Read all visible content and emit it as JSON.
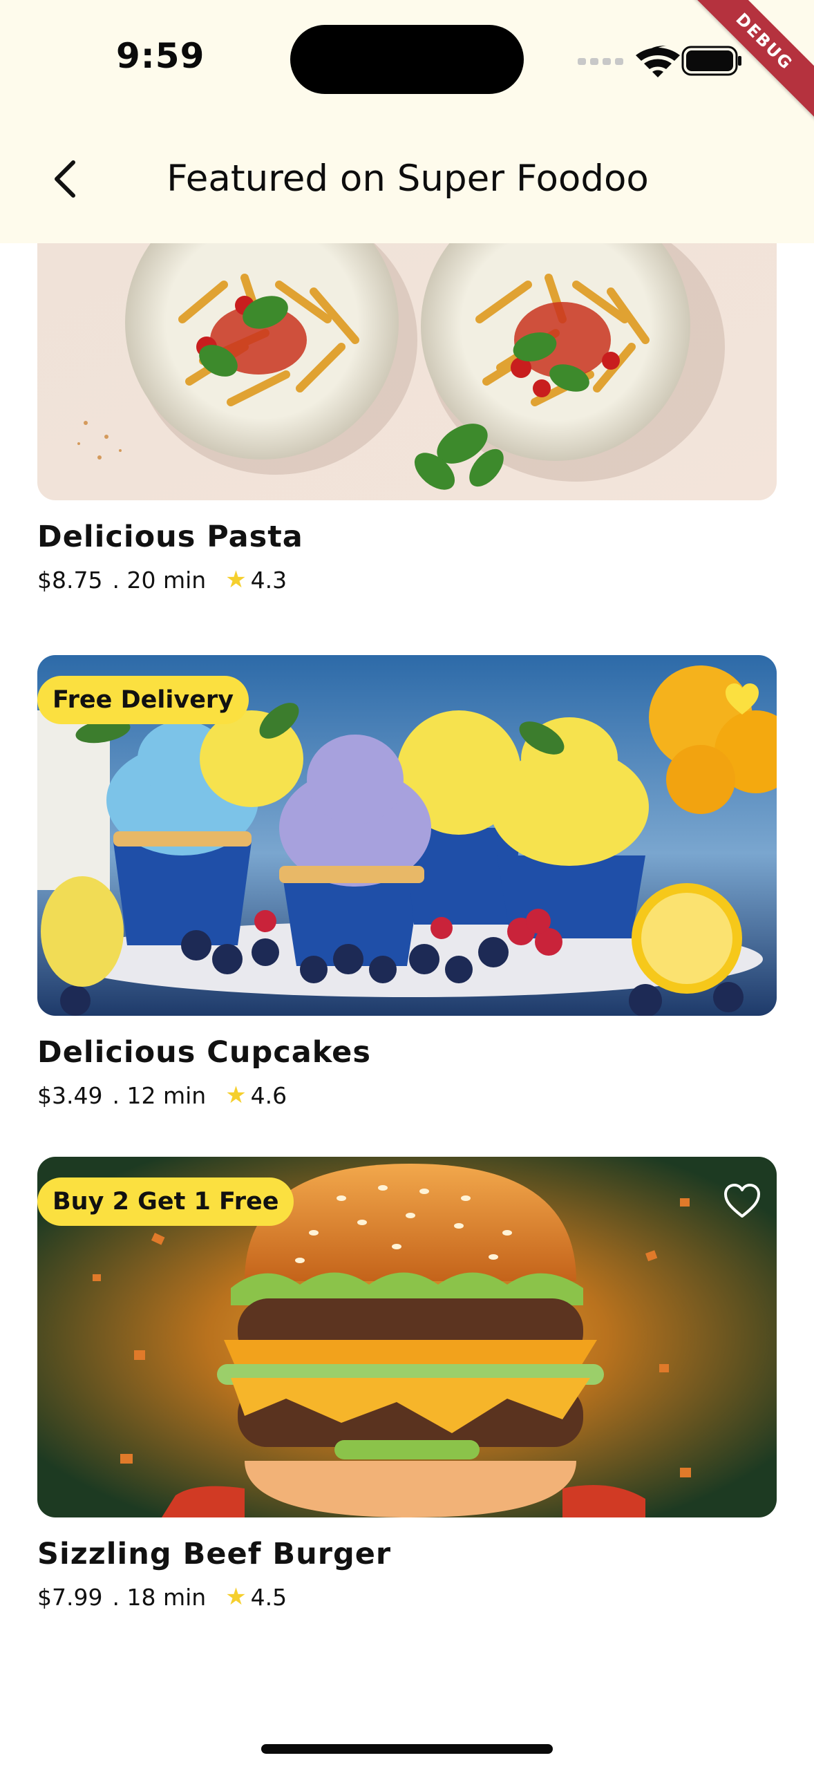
{
  "status_bar": {
    "time": "9:59"
  },
  "debug_banner": "DEBUG",
  "header": {
    "title": "Featured on Super Foodoo",
    "back_icon": "chevron-left-icon"
  },
  "items": [
    {
      "title": "Delicious Pasta",
      "price": "$8.75",
      "time": ". 20 min",
      "rating": "4.3",
      "badge": "",
      "favorite": false,
      "image": "pasta-plates"
    },
    {
      "title": "Delicious Cupcakes",
      "price": "$3.49",
      "time": ". 12 min",
      "rating": "4.6",
      "badge": "Free Delivery",
      "favorite": true,
      "image": "cupcakes"
    },
    {
      "title": "Sizzling Beef Burger",
      "price": "$7.99",
      "time": ". 18 min",
      "rating": "4.5",
      "badge": "Buy 2 Get 1 Free",
      "favorite": false,
      "image": "burger"
    }
  ],
  "colors": {
    "header_bg": "#fefbec",
    "badge_bg": "#fbe040",
    "star": "#f5cf2d",
    "favorite_active": "#fbe040",
    "debug_ribbon": "#b5323e"
  }
}
